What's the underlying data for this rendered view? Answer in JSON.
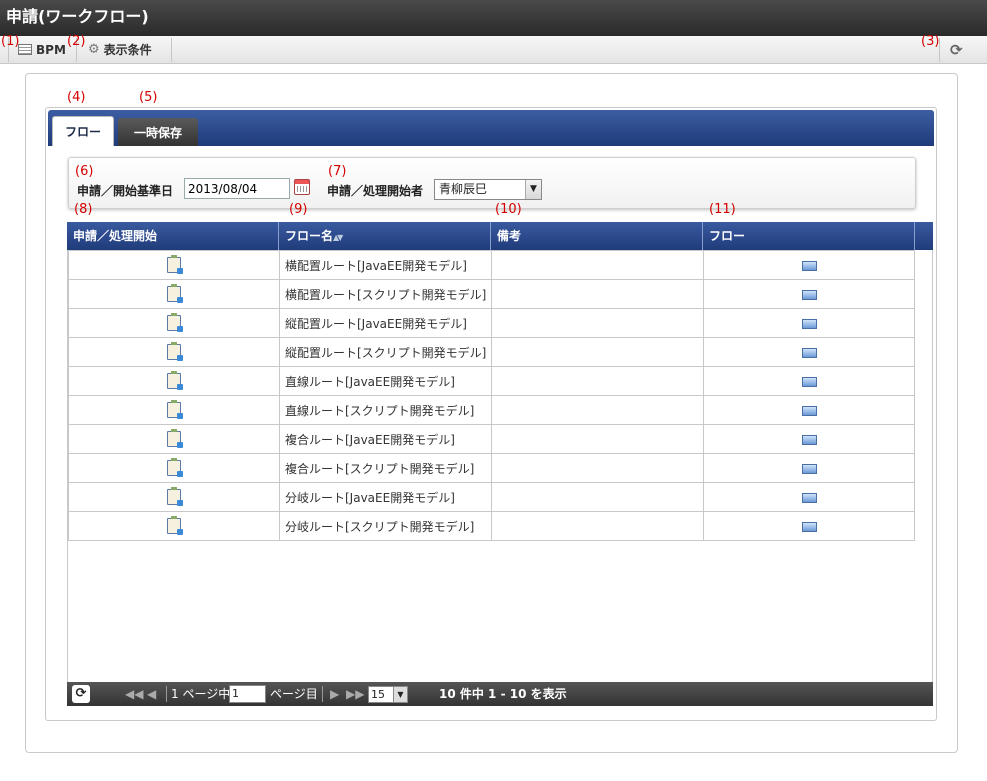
{
  "window": {
    "title": "申請(ワークフロー)"
  },
  "toolbar": {
    "bpm_label": "BPM",
    "display_condition_label": "表示条件"
  },
  "annotations": [
    "(1)",
    "(2)",
    "(3)",
    "(4)",
    "(5)",
    "(6)",
    "(7)",
    "(8)",
    "(9)",
    "(10)",
    "(11)"
  ],
  "tabs": [
    {
      "label": "フロー",
      "active": true
    },
    {
      "label": "一時保存",
      "active": false
    }
  ],
  "search": {
    "base_date_label": "申請／開始基準日",
    "base_date_value": "2013/08/04",
    "starter_label": "申請／処理開始者",
    "starter_value": "青柳辰巳"
  },
  "grid": {
    "columns": [
      "申請／処理開始",
      "フロー名",
      "備考",
      "フロー"
    ],
    "sort_indicator": "▲▼",
    "rows": [
      {
        "flow_name": "横配置ルート[JavaEE開発モデル]",
        "remarks": ""
      },
      {
        "flow_name": "横配置ルート[スクリプト開発モデル]",
        "remarks": ""
      },
      {
        "flow_name": "縦配置ルート[JavaEE開発モデル]",
        "remarks": ""
      },
      {
        "flow_name": "縦配置ルート[スクリプト開発モデル]",
        "remarks": ""
      },
      {
        "flow_name": "直線ルート[JavaEE開発モデル]",
        "remarks": ""
      },
      {
        "flow_name": "直線ルート[スクリプト開発モデル]",
        "remarks": ""
      },
      {
        "flow_name": "複合ルート[JavaEE開発モデル]",
        "remarks": ""
      },
      {
        "flow_name": "複合ルート[スクリプト開発モデル]",
        "remarks": ""
      },
      {
        "flow_name": "分岐ルート[JavaEE開発モデル]",
        "remarks": ""
      },
      {
        "flow_name": "分岐ルート[スクリプト開発モデル]",
        "remarks": ""
      }
    ]
  },
  "pager": {
    "page_prefix": "1 ページ中",
    "page_value": "1",
    "page_suffix": "ページ目",
    "page_size": "15",
    "summary": "10 件中 1 - 10 を表示"
  },
  "colors": {
    "header_blue": "#1f3b7a",
    "annotation_red": "#d40000"
  }
}
